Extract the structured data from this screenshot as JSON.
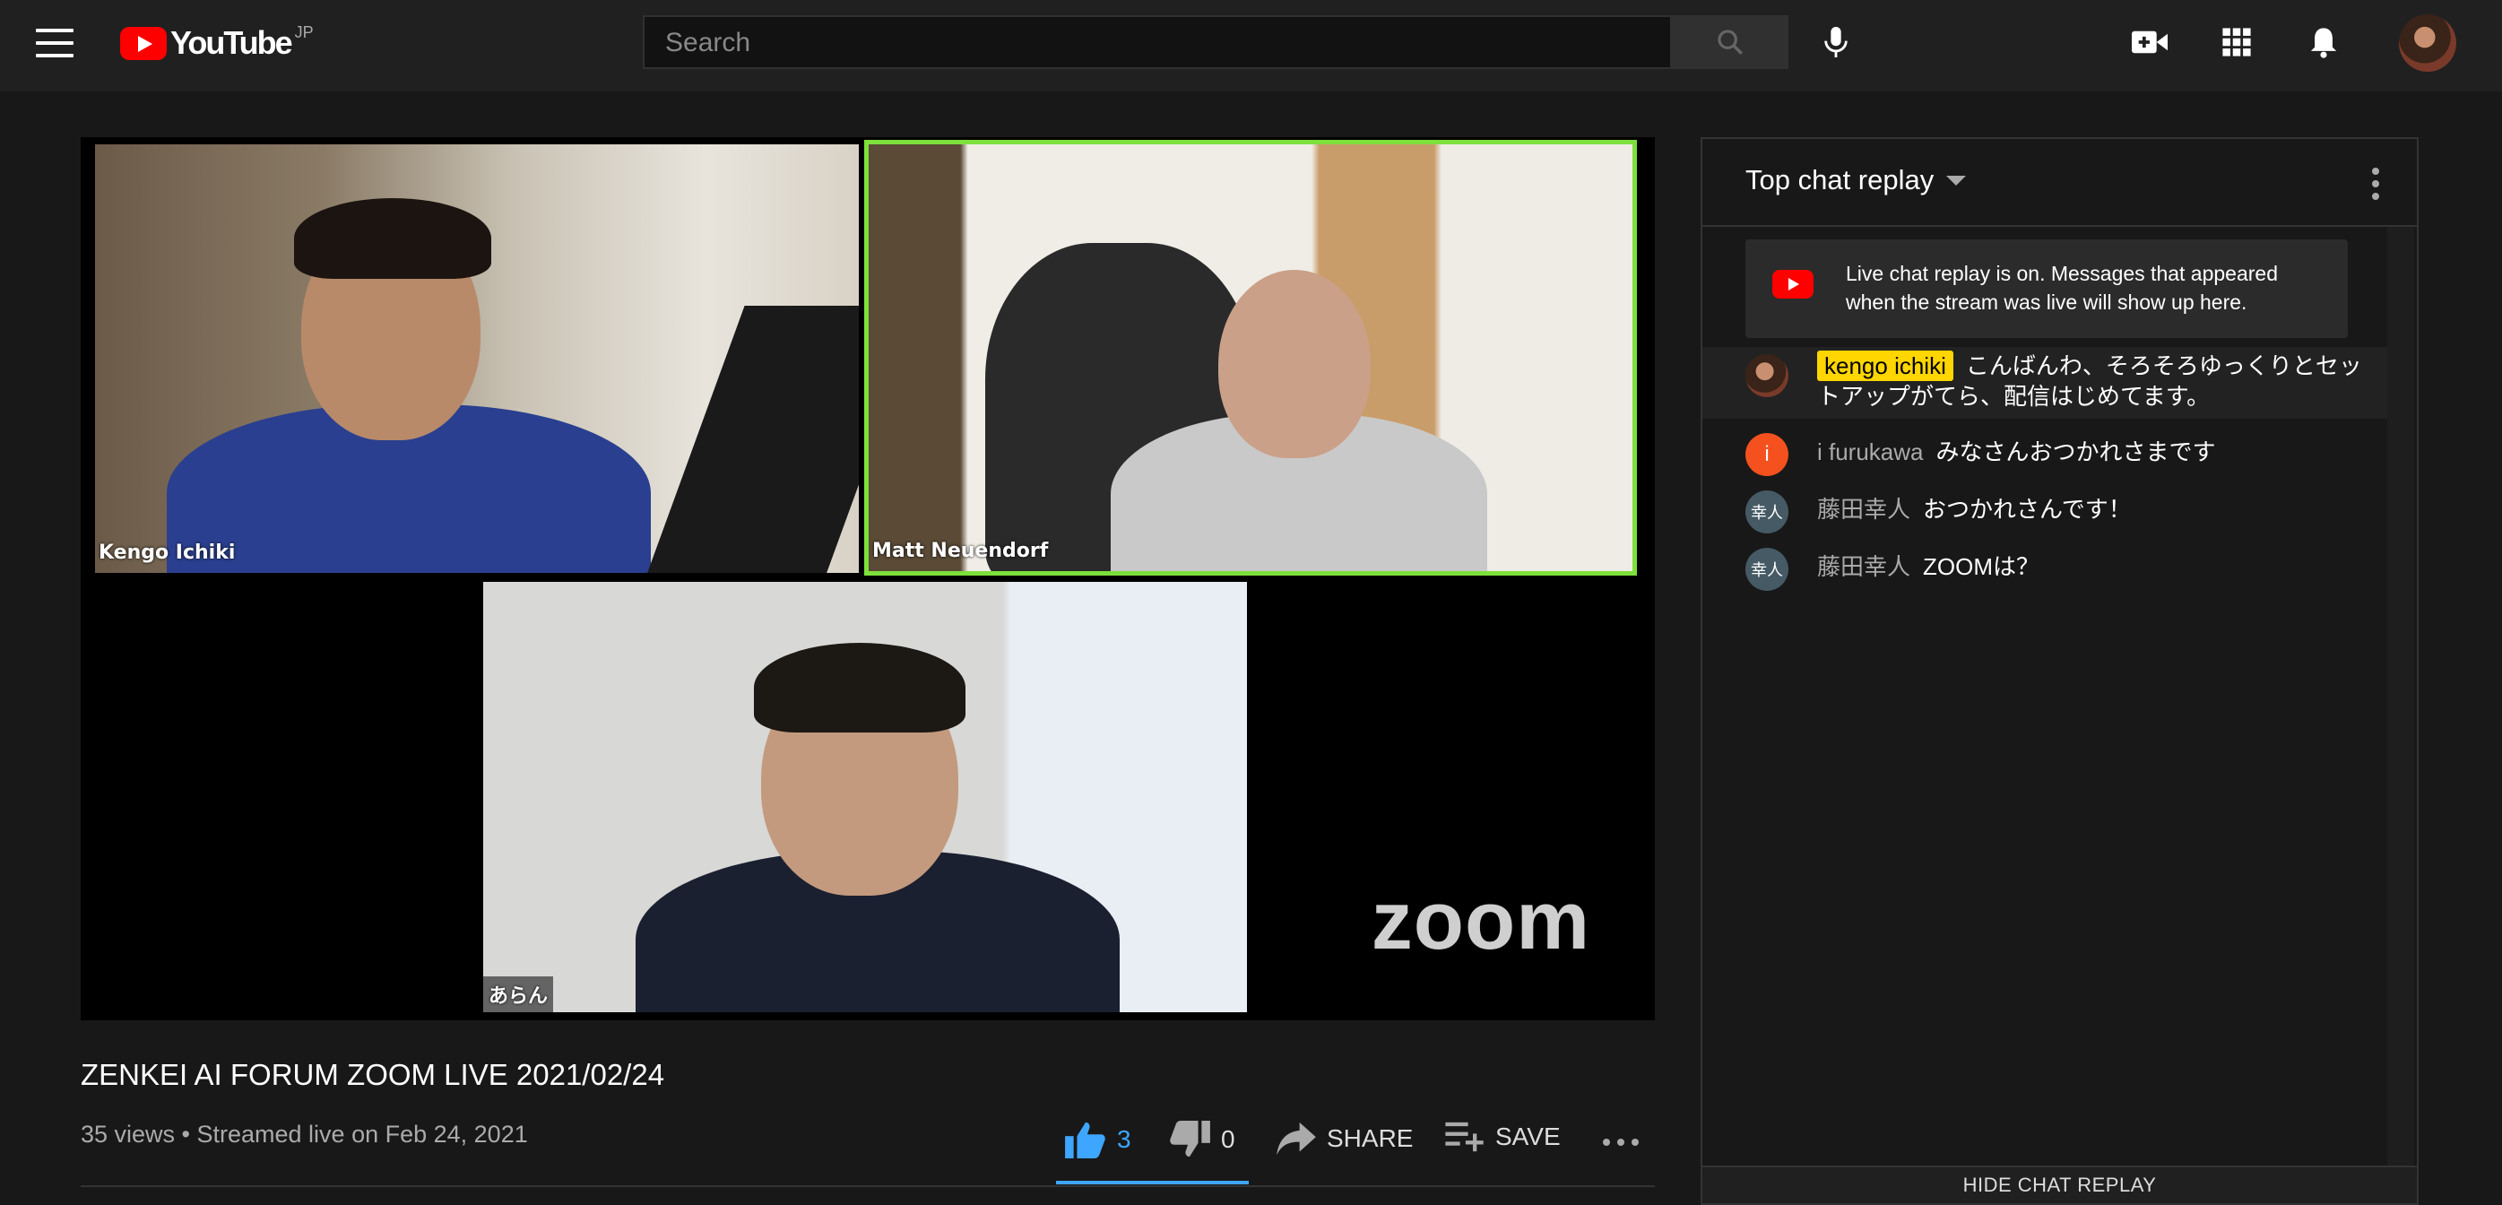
{
  "masthead": {
    "logo_text": "YouTube",
    "region": "JP",
    "search_placeholder": "Search"
  },
  "video": {
    "participants": [
      {
        "name": "Kengo Ichiki"
      },
      {
        "name": "Matt Neuendorf"
      },
      {
        "name": "あらん"
      }
    ],
    "zoom_logo": "zoom"
  },
  "info": {
    "title": "ZENKEI AI FORUM ZOOM LIVE 2021/02/24",
    "meta": "35 views • Streamed live on Feb 24, 2021",
    "likes": "3",
    "dislikes": "0",
    "share_label": "SHARE",
    "save_label": "SAVE"
  },
  "chat": {
    "title": "Top chat replay",
    "notice": "Live chat replay is on. Messages that appeared when the stream was live will show up here.",
    "messages": [
      {
        "author": "kengo ichiki",
        "text": "こんばんわ、そろそろゆっくりとセットアップがてら、配信はじめてます。",
        "owner": true
      },
      {
        "author": "i furukawa",
        "text": "みなさんおつかれさまです",
        "avatar_letter": "i",
        "avatar_color": "#f4511e"
      },
      {
        "author": "藤田幸人",
        "text": "おつかれさんです！",
        "avatar_letter": "幸人",
        "avatar_color": "#455a64"
      },
      {
        "author": "藤田幸人",
        "text": "ZOOMは？",
        "avatar_letter": "幸人",
        "avatar_color": "#455a64"
      }
    ],
    "hide_label": "HIDE CHAT REPLAY"
  },
  "colors": {
    "accent_blue": "#3ea6ff",
    "brand_red": "#ff0000",
    "active_speaker": "#7ee03a",
    "owner_badge": "#ffd600"
  }
}
